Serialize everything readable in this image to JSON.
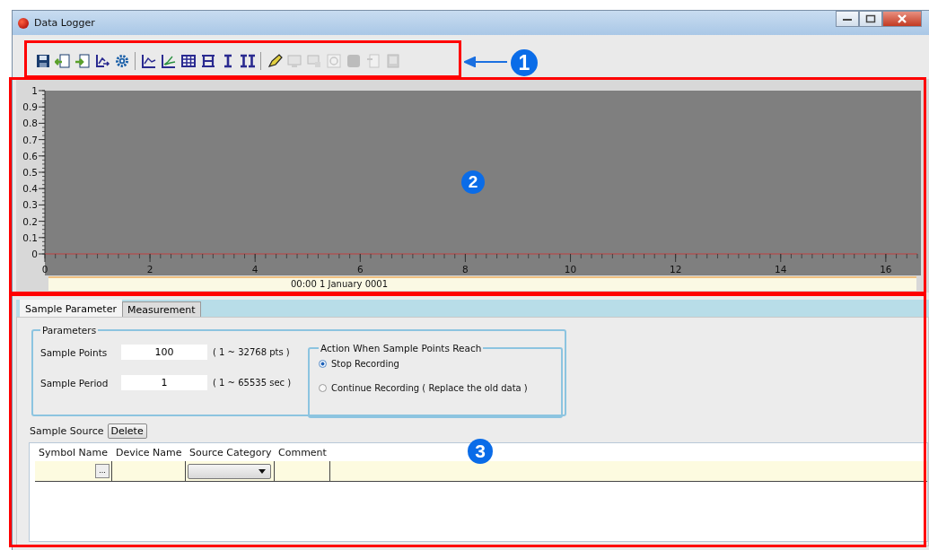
{
  "window": {
    "title": "Data Logger"
  },
  "toolbar": {
    "groups": [
      [
        {
          "disabled": false
        },
        {
          "disabled": false
        },
        {
          "disabled": false
        },
        {
          "disabled": false
        },
        {
          "disabled": false
        }
      ],
      [
        {
          "disabled": false
        },
        {
          "disabled": false
        },
        {
          "disabled": false
        },
        {
          "disabled": false
        },
        {
          "disabled": false
        },
        {
          "disabled": false
        }
      ],
      [
        {
          "disabled": false
        },
        {
          "disabled": true
        },
        {
          "disabled": true
        },
        {
          "disabled": true
        },
        {
          "disabled": true
        },
        {
          "disabled": true
        },
        {
          "disabled": true
        }
      ]
    ]
  },
  "chart": {
    "chart_data": {
      "type": "line",
      "xlim": [
        0,
        16.6
      ],
      "ylim": [
        0,
        1
      ],
      "xticks": [
        0,
        2,
        4,
        6,
        8,
        10,
        12,
        14,
        16
      ],
      "yticks": [
        0,
        0.1,
        0.2,
        0.3,
        0.4,
        0.5,
        0.6,
        0.7,
        0.8,
        0.9,
        1
      ]
    },
    "timestamp": "00:00 1 January 0001"
  },
  "tabs": [
    {
      "label": "Sample Parameter",
      "selected": true
    },
    {
      "label": "Measurement",
      "selected": false
    }
  ],
  "parameters": {
    "title": "Parameters",
    "fields": [
      {
        "label": "Sample Points",
        "value": "100",
        "range": "( 1 ~ 32768 pts )"
      },
      {
        "label": "Sample Period",
        "value": "1",
        "range": "( 1 ~ 65535 sec )"
      }
    ],
    "action": {
      "title": "Action When Sample Points Reach",
      "options": [
        {
          "label": "Stop Recording",
          "selected": true
        },
        {
          "label": "Continue Recording ( Replace the old data )",
          "selected": false
        }
      ]
    }
  },
  "sample_source": {
    "label": "Sample Source",
    "delete_button": "Delete",
    "columns": [
      "Symbol Name",
      "Device Name",
      "Source Category",
      "Comment"
    ],
    "browse_button": "..."
  },
  "callouts": [
    "1",
    "2",
    "3"
  ]
}
